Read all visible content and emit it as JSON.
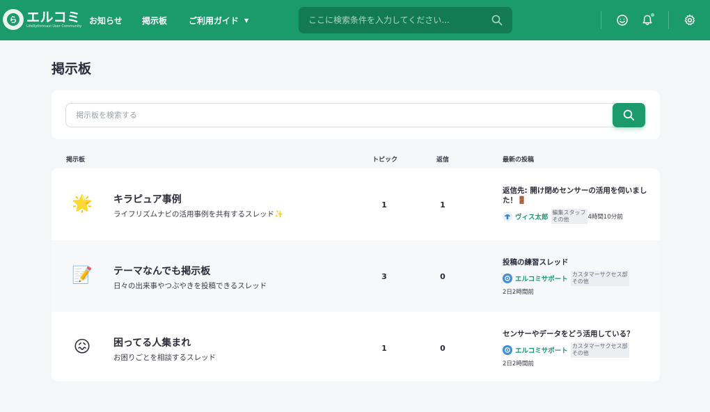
{
  "header": {
    "logo_text": "エルコミ",
    "logo_subtext": "LifeRythmnavi User Community",
    "nav": [
      {
        "label": "お知らせ"
      },
      {
        "label": "掲示板"
      },
      {
        "label": "ご利用ガイド"
      }
    ],
    "search_placeholder": "ここに検索条件を入力してください...",
    "icons": [
      "search-icon",
      "smile-icon",
      "bell-icon",
      "gear-icon"
    ],
    "accent_color": "#1b9a6c"
  },
  "page": {
    "title": "掲示板",
    "search_placeholder": "掲示板を検索する"
  },
  "table": {
    "columns": [
      "掲示板",
      "トピック",
      "返信",
      "最新の投稿"
    ],
    "rows": [
      {
        "emoji": "🌟",
        "title": "キラピュア事例",
        "description": "ライフリズムナビの活用事例を共有するスレッド✨",
        "topics": "1",
        "replies": "1",
        "latest_title": "返信先: 開け閉めセンサーの活用を伺いました！🚪",
        "latest_author": "ヴィス太郎",
        "latest_role": "編集スタッフ\nその他",
        "latest_time": "4時間10分前"
      },
      {
        "emoji": "📝",
        "title": "テーマなんでも掲示板",
        "description": "日々の出来事やつぶやきを投稿できるスレッド",
        "topics": "3",
        "replies": "0",
        "latest_title": "投稿の練習スレッド",
        "latest_author": "エルコミサポート",
        "latest_role": "カスタマーサクセス部\nその他",
        "latest_time": "2日2時間前"
      },
      {
        "emoji": "😖",
        "title": "困ってる人集まれ",
        "description": "お困りごとを相談するスレッド",
        "topics": "1",
        "replies": "0",
        "latest_title": "センサーやデータをどう活用している？",
        "latest_author": "エルコミサポート",
        "latest_role": "カスタマーサクセス部\nその他",
        "latest_time": "2日2時間前"
      }
    ]
  }
}
